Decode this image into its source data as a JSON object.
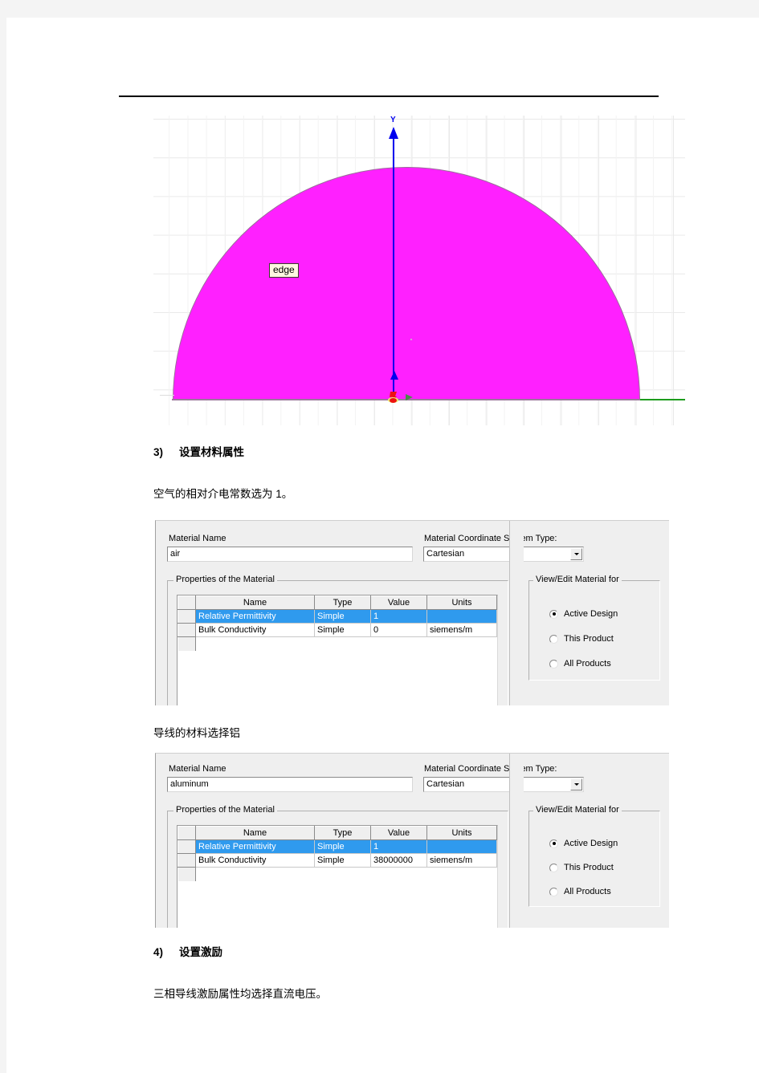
{
  "document": {
    "cad_figure": {
      "axis_y_label": "Y",
      "edge_tooltip": "edge",
      "shape_color": "#ff20ff",
      "y_axis_color": "#0000ee",
      "x_axis_color": "#1c9c1c",
      "origin_color": "#ee1111"
    },
    "sections": [
      {
        "number": "3)",
        "heading": "设置材料属性",
        "paragraph": "空气的相对介电常数选为 1。"
      },
      {
        "caption": "导线的材料选择铝"
      },
      {
        "number": "4)",
        "heading": "设置激励",
        "paragraph": "三相导线激励属性均选择直流电压。"
      }
    ]
  },
  "dialogs": [
    {
      "id": "air",
      "material_name_label": "Material Name",
      "material_name_value": "air",
      "coord_system_label": "Material Coordinate System Type:",
      "coord_system_value": "Cartesian",
      "properties_group_title": "Properties of the Material",
      "view_edit_group_title": "View/Edit Material for",
      "table": {
        "headers": [
          "Name",
          "Type",
          "Value",
          "Units"
        ],
        "rows": [
          {
            "name": "Relative Permittivity",
            "type": "Simple",
            "value": "1",
            "units": "",
            "selected": true
          },
          {
            "name": "Bulk Conductivity",
            "type": "Simple",
            "value": "0",
            "units": "siemens/m",
            "selected": false
          }
        ]
      },
      "radios": [
        {
          "label": "Active Design",
          "checked": true
        },
        {
          "label": "This Product",
          "checked": false
        },
        {
          "label": "All Products",
          "checked": false
        }
      ]
    },
    {
      "id": "aluminum",
      "material_name_label": "Material Name",
      "material_name_value": "aluminum",
      "coord_system_label": "Material Coordinate System Type:",
      "coord_system_value": "Cartesian",
      "properties_group_title": "Properties of the Material",
      "view_edit_group_title": "View/Edit Material for",
      "table": {
        "headers": [
          "Name",
          "Type",
          "Value",
          "Units"
        ],
        "rows": [
          {
            "name": "Relative Permittivity",
            "type": "Simple",
            "value": "1",
            "units": "",
            "selected": true
          },
          {
            "name": "Bulk Conductivity",
            "type": "Simple",
            "value": "38000000",
            "units": "siemens/m",
            "selected": false
          }
        ]
      },
      "radios": [
        {
          "label": "Active Design",
          "checked": true
        },
        {
          "label": "This Product",
          "checked": false
        },
        {
          "label": "All Products",
          "checked": false
        }
      ]
    }
  ]
}
